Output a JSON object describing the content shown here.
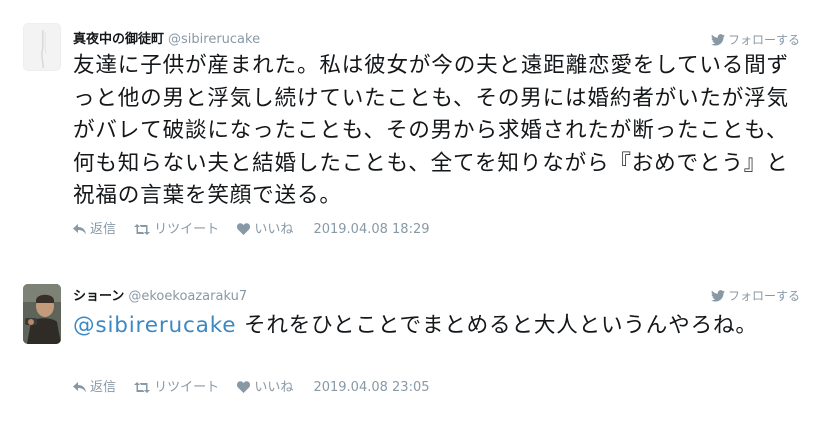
{
  "tweets": [
    {
      "display_name": "真夜中の御徒町",
      "screen_name": "@sibirerucake",
      "follow_label": "フォローする",
      "text": "友達に子供が産まれた。私は彼女が今の夫と遠距離恋愛をしている間ずっと他の男と浮気し続けていたことも、その男には婚約者がいたが浮気がバレて破談になったことも、その男から求婚されたが断ったことも、何も知らない夫と結婚したことも、全てを知りながら『おめでとう』と祝福の言葉を笑顔で送る。",
      "actions": {
        "reply": "返信",
        "retweet": "リツイート",
        "like": "いいね"
      },
      "timestamp": "2019.04.08 18:29"
    },
    {
      "display_name": "ショーン",
      "screen_name": "@ekoekoazaraku7",
      "follow_label": "フォローする",
      "mention": "@sibirerucake",
      "text": " それをひとことでまとめると大人というんやろね。",
      "actions": {
        "reply": "返信",
        "retweet": "リツイート",
        "like": "いいね"
      },
      "timestamp": "2019.04.08 23:05"
    }
  ],
  "colors": {
    "text": "#14171a",
    "muted": "#8899a6",
    "link": "#3b88c3"
  },
  "icons": [
    "twitter-bird-icon",
    "reply-icon",
    "retweet-icon",
    "heart-icon"
  ]
}
